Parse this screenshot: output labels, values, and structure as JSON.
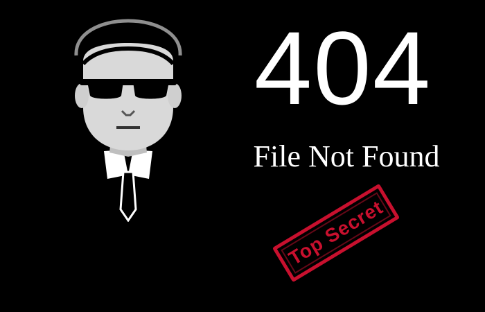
{
  "error": {
    "code": "404",
    "message": "File Not Found"
  },
  "stamp": {
    "label": "Top Secret"
  },
  "illustration": {
    "icon": "secret-agent-icon"
  },
  "colors": {
    "background": "#000000",
    "text": "#ffffff",
    "stamp": "#c8102e",
    "face": "#d9d9d9"
  }
}
